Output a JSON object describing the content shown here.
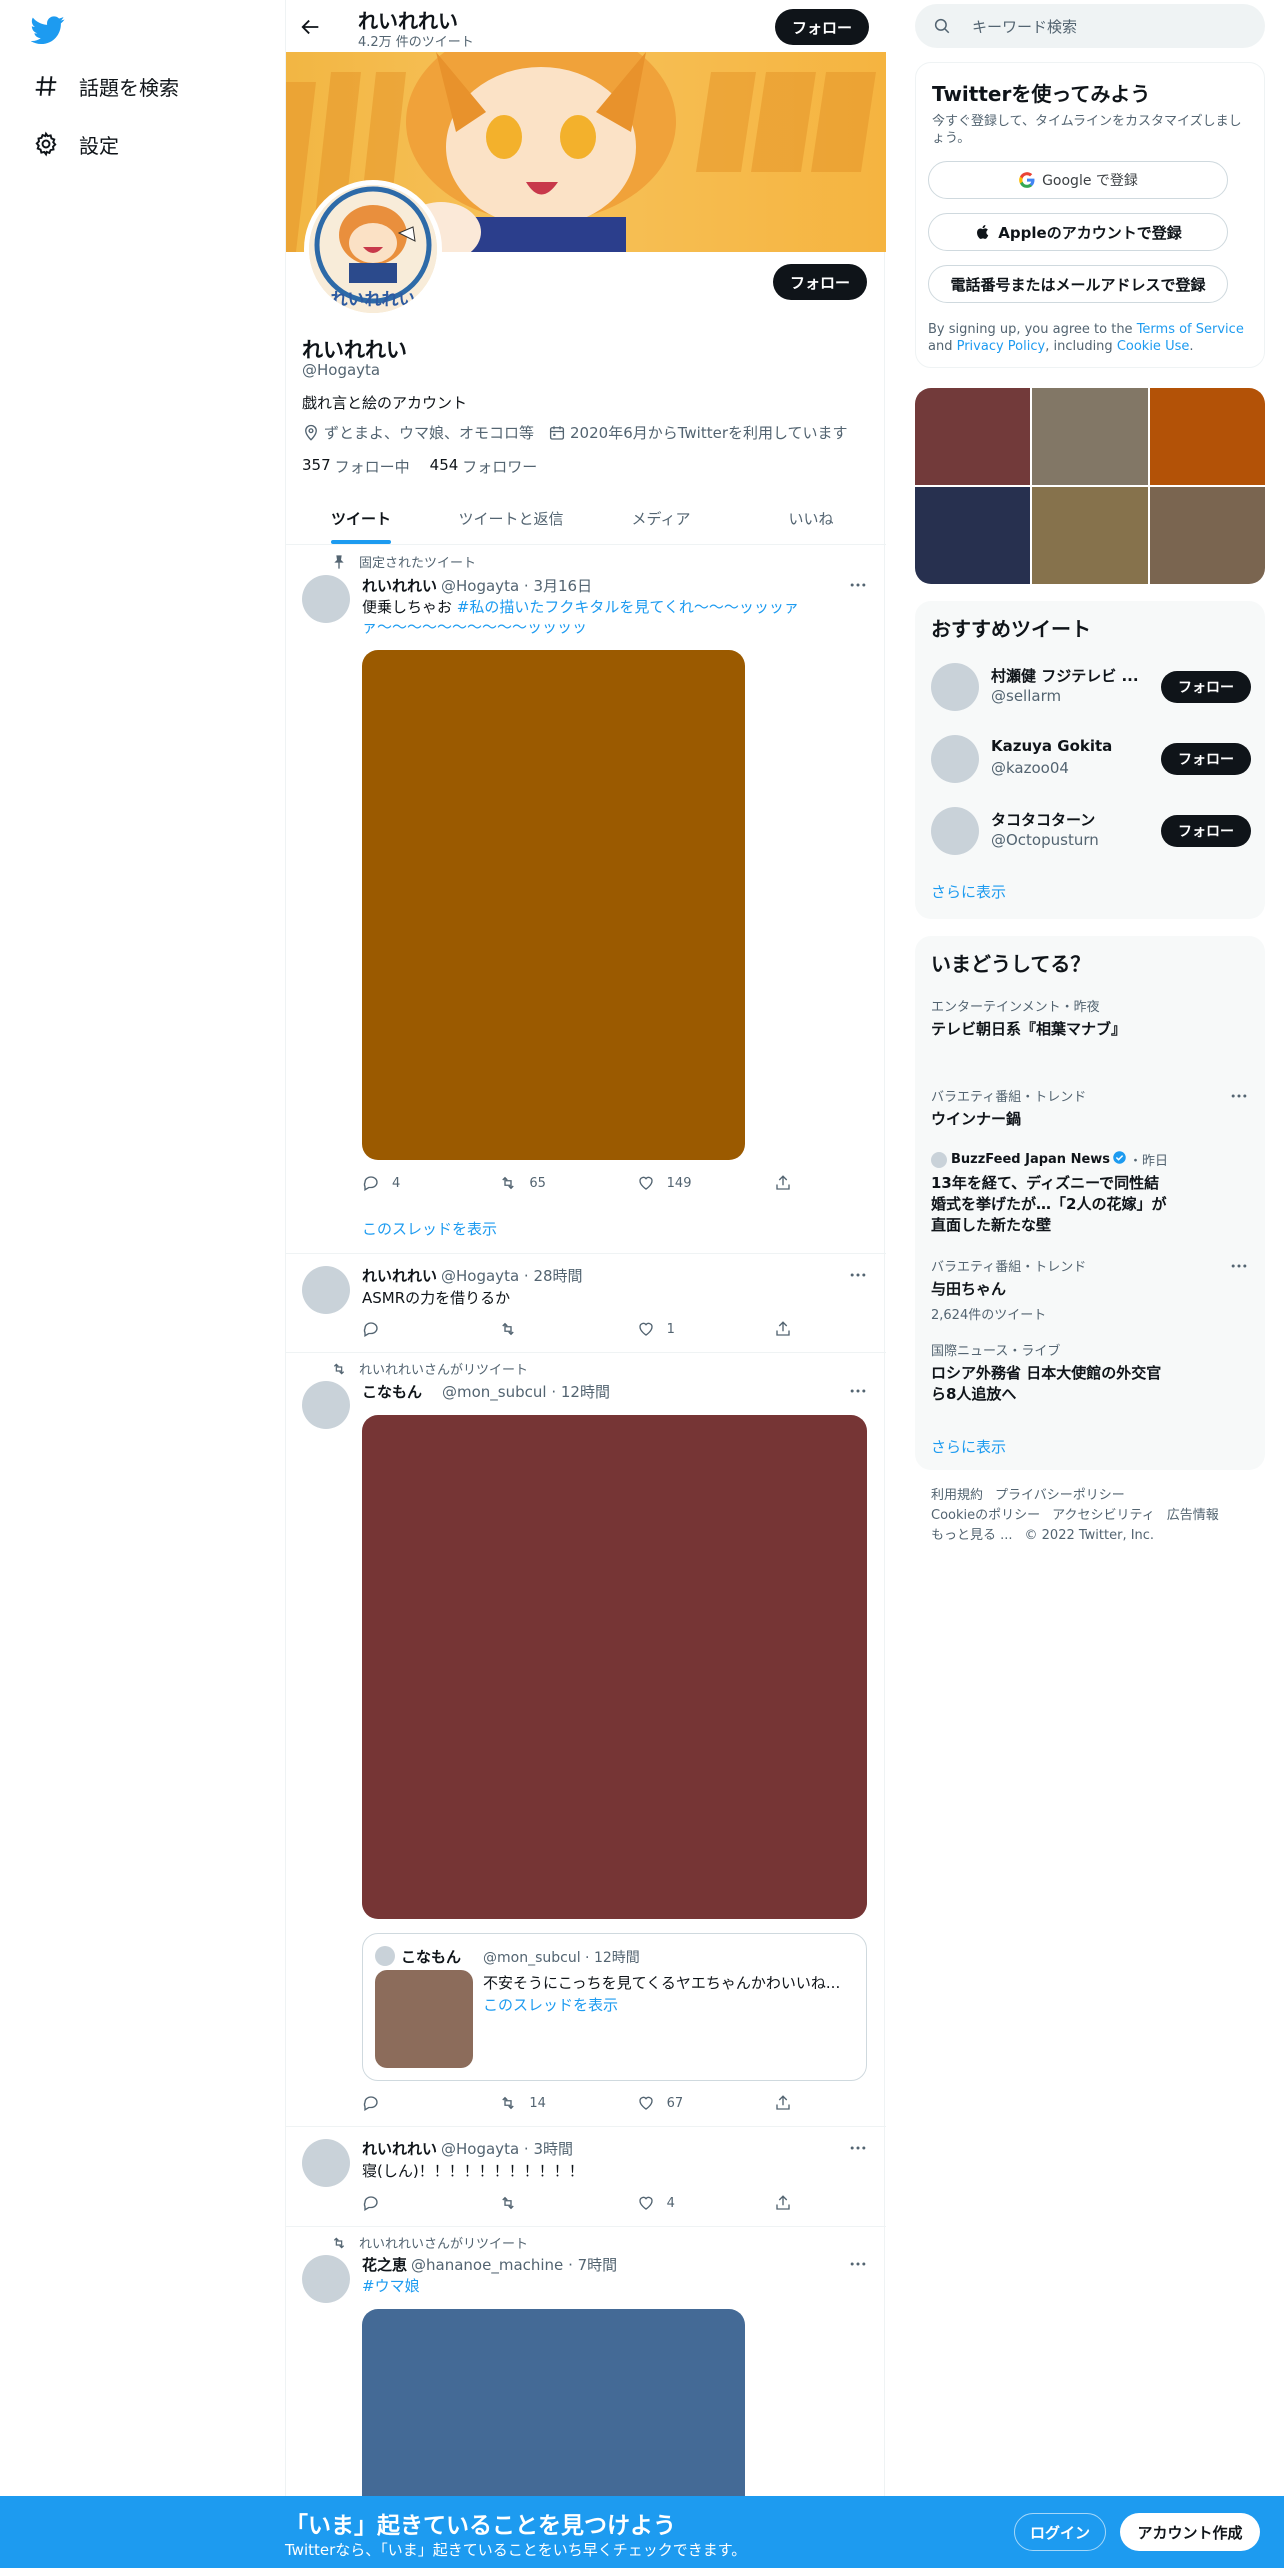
{
  "sidebar": {
    "items": [
      {
        "label": "話題を検索",
        "icon": "hashtag-icon"
      },
      {
        "label": "設定",
        "icon": "gear-icon"
      }
    ]
  },
  "topbar": {
    "name": "れいれれい",
    "tweet_count": "4.2万 件のツイート",
    "follow": "フォロー"
  },
  "profile": {
    "avatar_text": "れいれれい",
    "name": "れいれれい",
    "handle": "@Hogayta",
    "bio": "戯れ言と絵のアカウント",
    "location": "ずとまよ、ウマ娘、オモコロ等",
    "joined": "2020年6月からTwitterを利用しています",
    "following_count": "357",
    "following_label": "フォロー中",
    "followers_count": "454",
    "followers_label": "フォロワー",
    "follow": "フォロー"
  },
  "tabs": [
    "ツイート",
    "ツイートと返信",
    "メディア",
    "いいね"
  ],
  "tweets": [
    {
      "context": "固定されたツイート",
      "name": "れいれれい",
      "handle": "@Hogayta",
      "time": "3月16日",
      "text": "便乗しちゃお ",
      "hashtag": "#私の描いたフクキタルを見てくれ〜〜〜ッッッァァ〜〜〜〜〜〜〜〜〜〜ッッッッ",
      "media_color": "#9b5a00",
      "replies": "4",
      "retweets": "65",
      "likes": "149",
      "thread_link": "このスレッドを表示"
    },
    {
      "name": "れいれれい",
      "handle": "@Hogayta",
      "time": "28時間",
      "text": "ASMRの力を借りるか",
      "replies": "",
      "retweets": "",
      "likes": "1"
    },
    {
      "context": "れいれれいさんがリツイート",
      "name": "こなもん",
      "handle": "@mon_subcul",
      "time": "12時間",
      "media_color": "#763535",
      "quote": {
        "name": "こなもん",
        "handle": "@mon_subcul · 12時間",
        "text": "不安そうにこっちを見てくるヤエちゃんかわいいね...",
        "link": "このスレッドを表示"
      },
      "replies": "",
      "retweets": "14",
      "likes": "67"
    },
    {
      "name": "れいれれい",
      "handle": "@Hogayta",
      "time": "3時間",
      "text": "寝(しん)！！！！！！！！！！！",
      "replies": "",
      "retweets": "",
      "likes": "4"
    },
    {
      "context": "れいれれいさんがリツイート",
      "name": "花之恵",
      "handle": "@hananoe_machine",
      "time": "7時間",
      "hashtag": "#ウマ娘",
      "media_color": "#446a96"
    }
  ],
  "right": {
    "search_placeholder": "キーワード検索",
    "signup": {
      "title": "Twitterを使ってみよう",
      "desc": "今すぐ登録して、タイムラインをカスタマイズしましょう。",
      "google": "Google で登録",
      "apple": "Appleのアカウントで登録",
      "phone": "電話番号またはメールアドレスで登録",
      "legal_1": "By signing up, you agree to the ",
      "tos": "Terms of Service",
      "legal_2": " and ",
      "privacy": "Privacy Policy",
      "legal_3": ", including ",
      "cookie": "Cookie Use",
      "legal_4": "."
    },
    "media_colors": [
      "#723a3a",
      "#827766",
      "#b35207",
      "#27304f",
      "#86724c",
      "#7a6550"
    ],
    "recommend": {
      "title": "おすすめツイート",
      "users": [
        {
          "name": "村瀬健 フジテレビ ...",
          "handle": "@sellarm",
          "btn": "フォロー"
        },
        {
          "name": "Kazuya Gokita",
          "handle": "@kazoo04",
          "btn": "フォロー"
        },
        {
          "name": "タコタコターン",
          "handle": "@Octopusturn",
          "btn": "フォロー"
        }
      ],
      "more": "さらに表示"
    },
    "trends": {
      "title": "いまどうしてる？",
      "items": [
        {
          "meta": "エンターテインメント・昨夜",
          "name": "テレビ朝日系『相葉マナブ』"
        },
        {
          "meta": "バラエティ番組・トレンド",
          "name": "ウインナー鍋"
        },
        {
          "meta_source": "BuzzFeed Japan News",
          "meta_time": "・昨日",
          "name": "13年を経て、ディズニーで同性結婚式を挙げたが…「2人の花嫁」が直面した新たな壁"
        },
        {
          "meta": "バラエティ番組・トレンド",
          "name": "与田ちゃん",
          "sub": "2,624件のツイート"
        },
        {
          "meta": "国際ニュース・ライブ",
          "name": "ロシア外務省 日本大使館の外交官ら8人追放へ"
        }
      ],
      "more": "さらに表示"
    },
    "footer": [
      "利用規約",
      "プライバシーポリシー",
      "Cookieのポリシー",
      "アクセシビリティ",
      "広告情報",
      "もっと見る ...",
      "© 2022 Twitter, Inc."
    ]
  },
  "bottom": {
    "title": "「いま」起きていることを見つけよう",
    "sub": "Twitterなら、「いま」起きていることをいち早くチェックできます。",
    "login": "ログイン",
    "signup": "アカウント作成"
  },
  "colors": {
    "accent": "#1d9bf0",
    "dark": "#0f1419",
    "muted": "#536471"
  }
}
